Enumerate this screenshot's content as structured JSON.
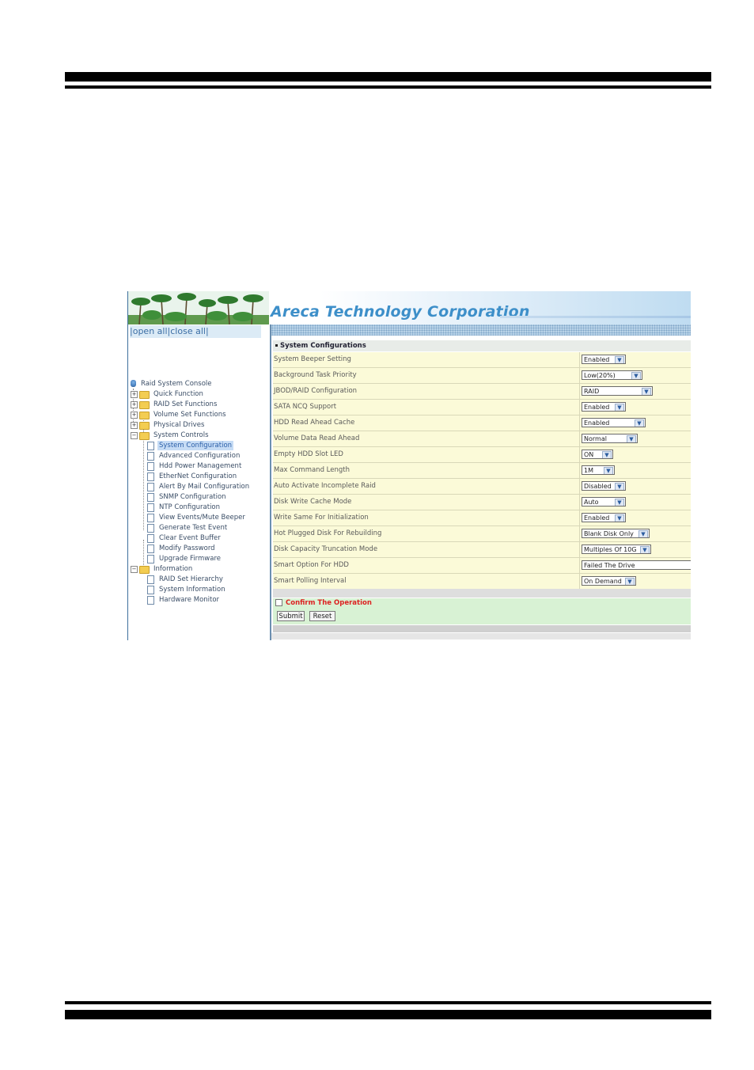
{
  "header": {
    "brand": "Areca Technology Corporation"
  },
  "sidebar": {
    "open_all": "open all",
    "close_all": "close all",
    "separator_left": "|",
    "separator_mid": "|",
    "separator_right": "|",
    "root": "Raid System Console",
    "items": [
      {
        "label": "Quick Function",
        "toggle": "+"
      },
      {
        "label": "RAID Set Functions",
        "toggle": "+"
      },
      {
        "label": "Volume Set Functions",
        "toggle": "+"
      },
      {
        "label": "Physical Drives",
        "toggle": "+"
      },
      {
        "label": "System Controls",
        "toggle": "−"
      }
    ],
    "system_controls_children": [
      "System Configuration",
      "Advanced Configuration",
      "Hdd Power Management",
      "EtherNet Configuration",
      "Alert By Mail Configuration",
      "SNMP Configuration",
      "NTP Configuration",
      "View Events/Mute Beeper",
      "Generate Test Event",
      "Clear Event Buffer",
      "Modify Password",
      "Upgrade Firmware"
    ],
    "information": {
      "label": "Information",
      "toggle": "−"
    },
    "information_children": [
      "RAID Set Hierarchy",
      "System Information",
      "Hardware Monitor"
    ],
    "selected": "System Configuration"
  },
  "main": {
    "section_title": "System Configurations",
    "rows": [
      {
        "label": "System Beeper Setting",
        "value": "Enabled"
      },
      {
        "label": "Background Task Priority",
        "value": "Low(20%)"
      },
      {
        "label": "JBOD/RAID Configuration",
        "value": "RAID"
      },
      {
        "label": "SATA NCQ Support",
        "value": "Enabled"
      },
      {
        "label": "HDD Read Ahead Cache",
        "value": "Enabled"
      },
      {
        "label": "Volume Data Read Ahead",
        "value": "Normal"
      },
      {
        "label": "Empty HDD Slot LED",
        "value": "ON"
      },
      {
        "label": "Max Command Length",
        "value": "1M"
      },
      {
        "label": "Auto Activate Incomplete Raid",
        "value": "Disabled"
      },
      {
        "label": "Disk Write Cache Mode",
        "value": "Auto"
      },
      {
        "label": "Write Same For Initialization",
        "value": "Enabled"
      },
      {
        "label": "Hot Plugged Disk For Rebuilding",
        "value": "Blank Disk Only"
      },
      {
        "label": "Disk Capacity Truncation Mode",
        "value": "Multiples Of 10G"
      },
      {
        "label": "Smart Option For HDD",
        "value": "Failed The Drive"
      },
      {
        "label": "Smart Polling Interval",
        "value": "On Demand"
      }
    ],
    "confirm_label": "Confirm The Operation",
    "submit_label": "Submit",
    "reset_label": "Reset"
  },
  "icons": {
    "dropdown": "chevron-down-icon",
    "folder": "folder-icon",
    "page": "page-icon",
    "root": "console-icon"
  },
  "colors": {
    "brand": "#3d8fc9",
    "row_bg": "#fbfad8",
    "confirm_bg": "#d8f2d4",
    "confirm_text": "#dd2222",
    "selected_bg": "#c6dcf5"
  }
}
